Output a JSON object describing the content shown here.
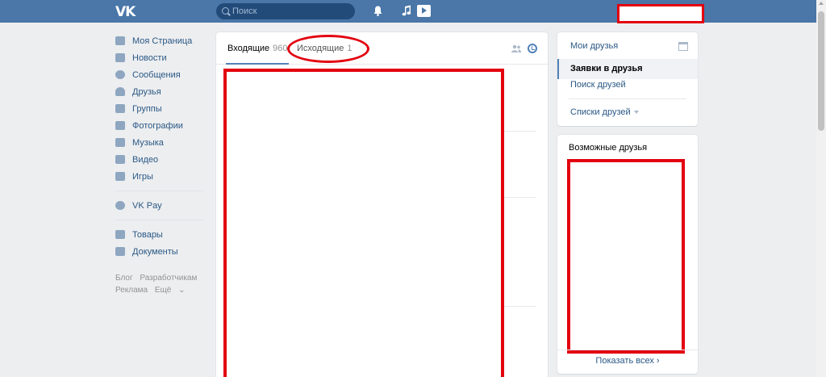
{
  "header": {
    "logo_text": "VK",
    "search_placeholder": "Поиск"
  },
  "menu": {
    "items": [
      {
        "label": "Моя Страница",
        "icon": "home-icon"
      },
      {
        "label": "Новости",
        "icon": "news-icon"
      },
      {
        "label": "Сообщения",
        "icon": "messages-icon"
      },
      {
        "label": "Друзья",
        "icon": "friend-icon"
      },
      {
        "label": "Группы",
        "icon": "groups-icon"
      },
      {
        "label": "Фотографии",
        "icon": "camera-icon"
      },
      {
        "label": "Музыка",
        "icon": "music-icon"
      },
      {
        "label": "Видео",
        "icon": "video-icon"
      },
      {
        "label": "Игры",
        "icon": "gamepad-icon"
      }
    ],
    "vkpay": {
      "label": "VK Pay",
      "icon": "vkpay-icon"
    },
    "extra": [
      {
        "label": "Товары",
        "icon": "bag-icon"
      },
      {
        "label": "Документы",
        "icon": "document-icon"
      }
    ],
    "footer": {
      "blog": "Блог",
      "developers": "Разработчикам",
      "ads": "Реклама",
      "more": "Ещё"
    }
  },
  "main": {
    "tab_incoming": {
      "label": "Входящие",
      "count": "960"
    },
    "tab_outgoing": {
      "label": "Исходящие",
      "count": "1"
    }
  },
  "right_nav": {
    "my_friends": "Мои друзья",
    "requests": "Заявки в друзья",
    "search": "Поиск друзей",
    "lists": "Списки друзей"
  },
  "possible_friends": {
    "title": "Возможные друзья",
    "show_all": "Показать всех"
  },
  "colors": {
    "header": "#4a76a8",
    "link": "#2a5885",
    "annotation": "#e3000f"
  }
}
